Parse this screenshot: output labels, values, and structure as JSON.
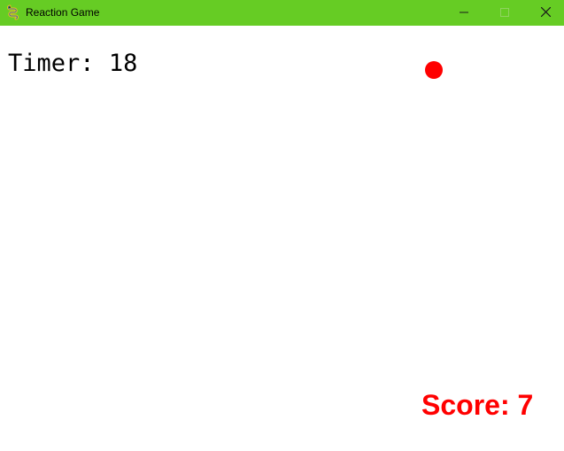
{
  "window": {
    "title": "Reaction Game",
    "titlebar_color": "#66cc24",
    "app_icon": "pygame-snake-icon",
    "controls": {
      "minimize_icon": "minimize-icon",
      "maximize_icon": "maximize-icon",
      "close_icon": "close-icon"
    }
  },
  "game": {
    "timer_label": "Timer:",
    "timer_value": "18",
    "score_label": "Score:",
    "score_value": "7",
    "score_color": "#ff0000",
    "target_color": "#ff0000"
  }
}
